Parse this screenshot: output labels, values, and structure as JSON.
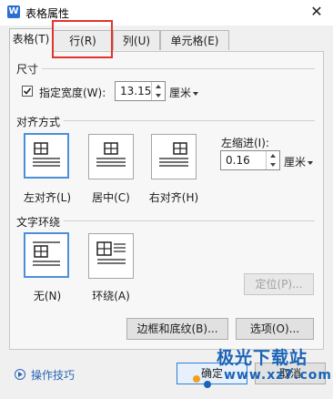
{
  "window": {
    "title": "表格属性",
    "close": "✕"
  },
  "tabs": [
    {
      "label": "表格(T)",
      "active": true
    },
    {
      "label": "行(R)",
      "active": false
    },
    {
      "label": "列(U)",
      "active": false
    },
    {
      "label": "单元格(E)",
      "active": false
    }
  ],
  "size": {
    "heading": "尺寸",
    "checkbox_checked": true,
    "checkbox_label": "指定宽度(W):",
    "width_value": "13.15",
    "unit": "厘米"
  },
  "alignment": {
    "heading": "对齐方式",
    "options": [
      {
        "label": "左对齐(L)",
        "selected": true
      },
      {
        "label": "居中(C)",
        "selected": false
      },
      {
        "label": "右对齐(H)",
        "selected": false
      }
    ],
    "indent_label": "左缩进(I):",
    "indent_value": "0.16",
    "indent_unit": "厘米"
  },
  "wrap": {
    "heading": "文字环绕",
    "options": [
      {
        "label": "无(N)",
        "selected": true
      },
      {
        "label": "环绕(A)",
        "selected": false
      }
    ],
    "position_button": "定位(P)..."
  },
  "buttons": {
    "borders": "边框和底纹(B)...",
    "options": "选项(O)...",
    "ok": "确定",
    "cancel": "取消"
  },
  "help": {
    "label": "操作技巧"
  },
  "watermark": {
    "brand": "极光下载站",
    "url": "www.xz7.com"
  },
  "colors": {
    "accent": "#4a90d9",
    "highlight": "#e0342c",
    "link": "#2a64b5"
  }
}
